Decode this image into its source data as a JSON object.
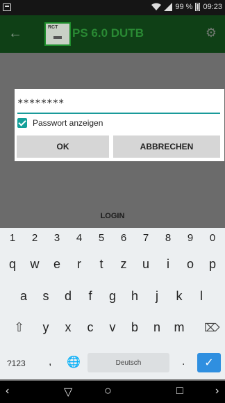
{
  "status_bar": {
    "battery_text": "99 %",
    "time": "09:23",
    "icons": [
      "notification-icon",
      "wifi-icon",
      "signal-icon",
      "battery-icon"
    ]
  },
  "app_bar": {
    "back_icon": "arrow-left-icon",
    "logo_text": "RCT",
    "title": "PS 6.0 DUTB",
    "settings_icon": "gear-icon"
  },
  "dialog": {
    "password_value": "********",
    "show_password_label": "Passwort anzeigen",
    "show_password_checked": true,
    "ok_label": "OK",
    "cancel_label": "ABBRECHEN",
    "accent_color": "#14a09a"
  },
  "login_label": "LOGIN",
  "keyboard": {
    "number_row": [
      "1",
      "2",
      "3",
      "4",
      "5",
      "6",
      "7",
      "8",
      "9",
      "0"
    ],
    "row1": [
      "q",
      "w",
      "e",
      "r",
      "t",
      "z",
      "u",
      "i",
      "o",
      "p"
    ],
    "row2": [
      "a",
      "s",
      "d",
      "f",
      "g",
      "h",
      "j",
      "k",
      "l"
    ],
    "row3": [
      "y",
      "x",
      "c",
      "v",
      "b",
      "n",
      "m"
    ],
    "symbols_label": "?123",
    "comma": ",",
    "space_label": "Deutsch",
    "period": ".",
    "enter_icon": "check-icon",
    "enter_color": "#2f8fe0"
  },
  "nav_bar": {
    "icons": [
      "back-nav-icon",
      "triangle-down-icon",
      "home-circle-icon",
      "recents-square-icon",
      "chevron-right-icon"
    ]
  }
}
